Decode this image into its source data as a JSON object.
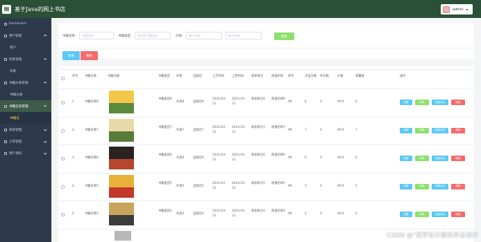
{
  "header": {
    "title": "基于Java的网上书店",
    "user": "admin"
  },
  "sidebar": {
    "items": [
      {
        "label": "Dashboard",
        "level": 0
      },
      {
        "label": "用户管理",
        "level": 0,
        "arrow": "up"
      },
      {
        "label": "用户",
        "level": 1
      },
      {
        "label": "商家管理",
        "level": 0,
        "arrow": "up"
      },
      {
        "label": "商家",
        "level": 1
      },
      {
        "label": "书籍分类管理",
        "level": 0,
        "arrow": "up"
      },
      {
        "label": "书籍分类",
        "level": 1
      },
      {
        "label": "书籍信息管理",
        "level": 0,
        "arrow": "up",
        "active": true
      },
      {
        "label": "书籍信",
        "level": 1,
        "active": true
      },
      {
        "label": "系统管理",
        "level": 0,
        "arrow": "down"
      },
      {
        "label": "订单管理",
        "level": 0,
        "arrow": "down"
      },
      {
        "label": "用户资料",
        "level": 0,
        "arrow": "down"
      }
    ]
  },
  "search": {
    "name_label": "书籍名称",
    "name_placeholder": "书籍名称",
    "type_label": "书籍类型",
    "type_placeholder": "请选择书籍类型",
    "price_label": "价格",
    "price_min_placeholder": "最小价格",
    "price_max_placeholder": "最大价格",
    "search_button": "搜索"
  },
  "actions": {
    "add": "新增",
    "delete": "删除"
  },
  "table": {
    "headers": [
      "序号",
      "书籍名称",
      "书籍封面",
      "书籍类型",
      "作者",
      "出版社",
      "上市时间",
      "上架时间",
      "商家账号",
      "商铺名称",
      "库存",
      "点击次数",
      "评论数",
      "价格",
      "销量数",
      "操作"
    ],
    "rows": [
      {
        "idx": "1",
        "name": "书籍名称8",
        "type": "书籍类型8",
        "author": "作者8",
        "publisher": "出版社8",
        "listed": "2024-03-31",
        "shelved": "2024-03-31",
        "account": "商家账号8",
        "shop": "商铺名称8",
        "stock": "99",
        "clicks": "8",
        "comments": "0",
        "price": "99.9",
        "sales": "8"
      },
      {
        "idx": "2",
        "name": "书籍名称7",
        "type": "书籍类型7",
        "author": "作者7",
        "publisher": "出版社7",
        "listed": "2024-03-31",
        "shelved": "2024-03-31",
        "account": "商家账号7",
        "shop": "商铺名称7",
        "stock": "99",
        "clicks": "7",
        "comments": "0",
        "price": "99.9",
        "sales": "7"
      },
      {
        "idx": "3",
        "name": "书籍名称6",
        "type": "书籍类型6",
        "author": "作者6",
        "publisher": "出版社6",
        "listed": "2024-03-31",
        "shelved": "2024-03-31",
        "account": "商家账号6",
        "shop": "商铺名称6",
        "stock": "99",
        "clicks": "6",
        "comments": "0",
        "price": "99.9",
        "sales": "6"
      },
      {
        "idx": "4",
        "name": "书籍名称5",
        "type": "书籍类型5",
        "author": "作者5",
        "publisher": "出版社5",
        "listed": "2024-03-31",
        "shelved": "2024-03-31",
        "account": "商家账号5",
        "shop": "商铺名称5",
        "stock": "99",
        "clicks": "5",
        "comments": "0",
        "price": "99.9",
        "sales": "5"
      },
      {
        "idx": "5",
        "name": "书籍名称4",
        "type": "书籍类型4",
        "author": "作者4",
        "publisher": "出版社4",
        "listed": "2024-03-31",
        "shelved": "2024-03-31",
        "account": "商家账号4",
        "shop": "商铺名称4",
        "stock": "99",
        "clicks": "4",
        "comments": "0",
        "price": "99.9",
        "sales": "4"
      }
    ],
    "ops": [
      "查看",
      "修改",
      "查看评论",
      "删除"
    ]
  },
  "colors": {
    "header_bg": "#2a5038",
    "sidebar_bg": "#2d3a4b",
    "view_btn": "#5bc8f5",
    "edit_btn": "#8fe070",
    "comment_btn": "#5bc8f5",
    "delete_btn": "#f56c6c"
  },
  "watermark": "CSDN @\"花学长计算机毕业设计"
}
